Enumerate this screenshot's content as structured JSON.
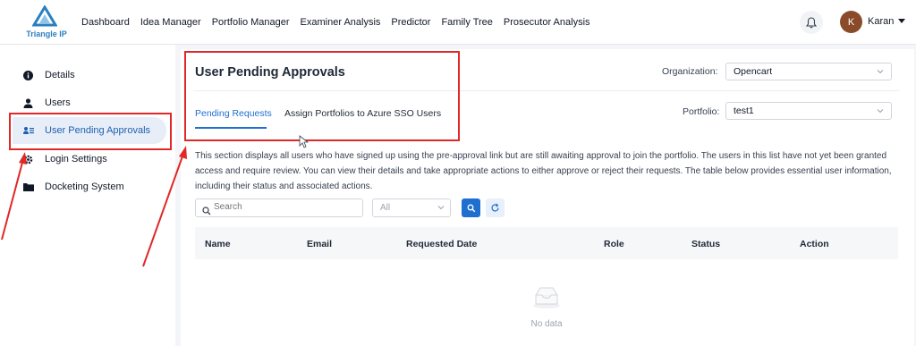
{
  "brand": {
    "name": "Triangle IP",
    "accent": "#1f6fd1",
    "annotation_color": "#e02828"
  },
  "nav": {
    "items": [
      "Dashboard",
      "Idea Manager",
      "Portfolio Manager",
      "Examiner Analysis",
      "Predictor",
      "Family Tree",
      "Prosecutor Analysis"
    ]
  },
  "user": {
    "initial": "K",
    "name": "Karan"
  },
  "sidebar": {
    "items": [
      {
        "label": "Details",
        "icon": "info-icon"
      },
      {
        "label": "Users",
        "icon": "user-icon"
      },
      {
        "label": "User Pending Approvals",
        "icon": "user-list-icon",
        "active": true
      },
      {
        "label": "Login Settings",
        "icon": "gear-icon"
      },
      {
        "label": "Docketing System",
        "icon": "folder-icon"
      }
    ]
  },
  "main": {
    "title": "User Pending Approvals",
    "tabs": [
      {
        "label": "Pending Requests",
        "active": true
      },
      {
        "label": "Assign Portfolios to Azure SSO Users"
      }
    ],
    "organization": {
      "label": "Organization:",
      "value": "Opencart"
    },
    "portfolio": {
      "label": "Portfolio:",
      "value": "test1"
    },
    "description": "This section displays all users who have signed up using the pre-approval link but are still awaiting approval to join the portfolio. The users in this list have not yet been granted access and require review. You can view their details and take appropriate actions to either approve or reject their requests. The table below provides essential user information, including their status and associated actions.",
    "search": {
      "placeholder": "Search"
    },
    "filter": {
      "value": "All"
    },
    "table": {
      "columns": [
        "Name",
        "Email",
        "Requested Date",
        "Role",
        "Status",
        "Action"
      ],
      "empty_text": "No data"
    }
  }
}
